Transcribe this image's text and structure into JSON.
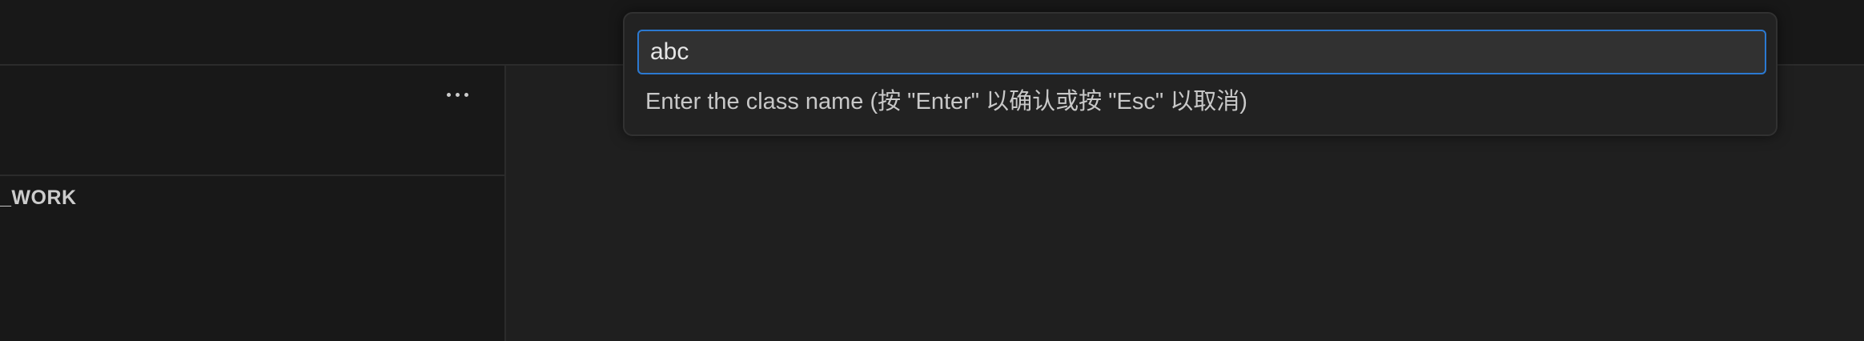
{
  "sidebar": {
    "section_title": "_WORK",
    "more_actions_icon": "ellipsis-icon"
  },
  "quick_input": {
    "value": "abc",
    "message": "Enter the class name (按 \"Enter\" 以确认或按 \"Esc\" 以取消)"
  },
  "colors": {
    "focus_border": "#2b79d1",
    "background": "#1f1f1f",
    "sidebar_background": "#181818"
  }
}
